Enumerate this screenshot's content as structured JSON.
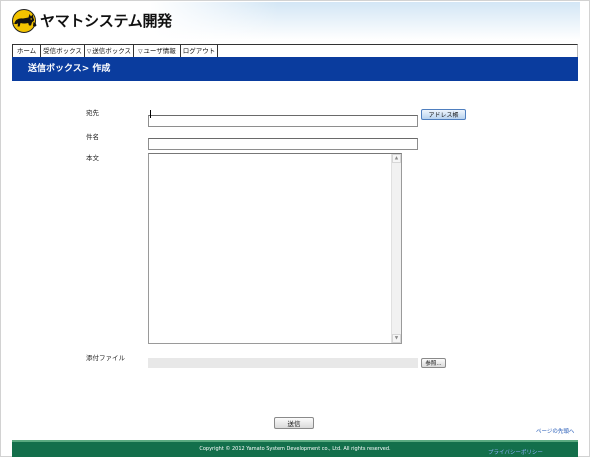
{
  "header": {
    "logo_text": "ヤマトシステム開発",
    "logo_icon": "black-cat-logo-icon"
  },
  "nav": {
    "items": [
      {
        "label": "ホーム",
        "dropdown": false
      },
      {
        "label": "受信ボックス",
        "dropdown": false
      },
      {
        "label": "送信ボックス",
        "dropdown": true
      },
      {
        "label": "ユーザ情報",
        "dropdown": true
      },
      {
        "label": "ログアウト",
        "dropdown": false
      }
    ],
    "dropdown_icon": "triangle-down-icon"
  },
  "page_title": "送信ボックス> 作成",
  "form": {
    "to": {
      "label": "宛先",
      "value": "",
      "address_book_label": "アドレス帳"
    },
    "subject": {
      "label": "件名",
      "value": ""
    },
    "body": {
      "label": "本文",
      "value": ""
    },
    "attachment": {
      "label": "添付ファイル",
      "browse_label": "参照..."
    },
    "send_label": "送信"
  },
  "links": {
    "page_top": "ページの先頭へ"
  },
  "footer": {
    "copyright": "Copyright © 2012 Yamato System Development co., Ltd. All rights reserved.",
    "privacy": "プライバシーポリシー"
  },
  "colors": {
    "title_bar": "#0a3c9e",
    "footer": "#136f4b",
    "link": "#1f56b5",
    "logo_yellow": "#f3c300"
  }
}
